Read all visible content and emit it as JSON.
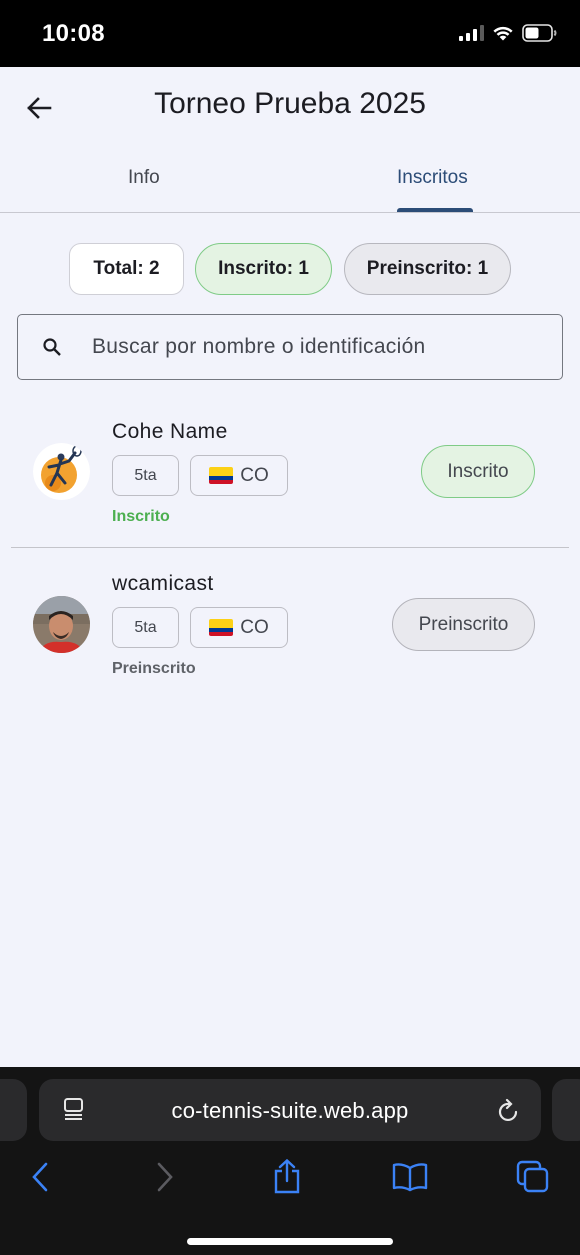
{
  "status_bar": {
    "time": "10:08"
  },
  "app_bar": {
    "title": "Torneo Prueba 2025"
  },
  "tabs": [
    {
      "label": "Info",
      "active": false
    },
    {
      "label": "Inscritos",
      "active": true
    }
  ],
  "summary": {
    "total": "Total: 2",
    "inscritos": "Inscrito: 1",
    "preinscritos": "Preinscrito: 1"
  },
  "search": {
    "placeholder": "Buscar por nombre o identificación",
    "value": ""
  },
  "players": [
    {
      "name": "Cohe Name",
      "category": "5ta",
      "country": "CO",
      "status": "Inscrito",
      "action": "Inscrito"
    },
    {
      "name": "wcamicast",
      "category": "5ta",
      "country": "CO",
      "status": "Preinscrito",
      "action": "Preinscrito"
    }
  ],
  "browser": {
    "url": "co-tennis-suite.web.app"
  },
  "colors": {
    "accent": "#2c4c77",
    "inscrito_green": "#4caf50",
    "inscrito_fill": "#e4f3e3",
    "preinscrito_fill": "#e9e9ee",
    "background": "#f2f3fb",
    "ios_blue": "#3b82f6"
  },
  "icons": [
    "back-arrow-icon",
    "search-icon",
    "tabs-icon",
    "reload-icon",
    "chevron-left-icon",
    "chevron-right-icon",
    "share-icon",
    "bookmarks-icon",
    "tabs-overview-icon"
  ]
}
